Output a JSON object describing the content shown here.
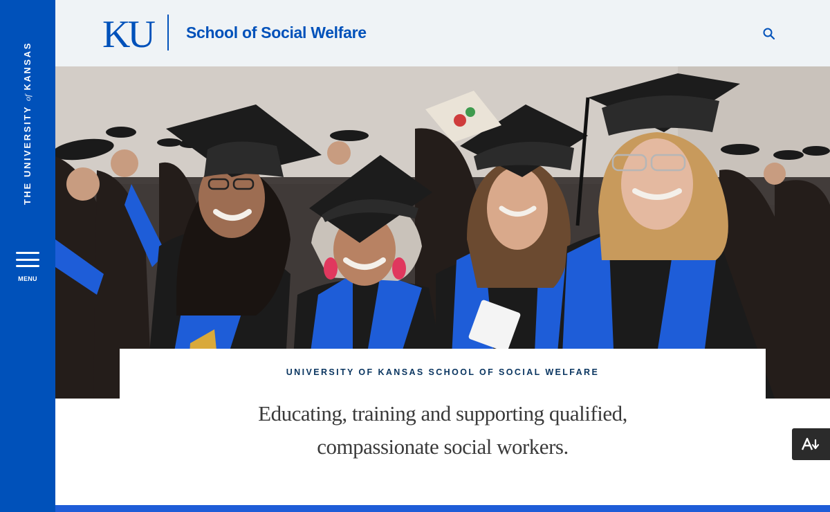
{
  "sidebar": {
    "wordmark_pre": "THE UNIVERSITY",
    "wordmark_of": "of",
    "wordmark_post": "KANSAS",
    "menu_label": "MENU",
    "menu_icon": "hamburger-icon"
  },
  "header": {
    "logo_text": "KU",
    "title": "School of Social Welfare",
    "search_icon": "search-icon"
  },
  "hero": {
    "eyebrow": "UNIVERSITY OF KANSAS SCHOOL OF SOCIAL WELFARE",
    "tagline_line1": "Educating, training and supporting qualified,",
    "tagline_line2": "compassionate social workers."
  },
  "accessibility": {
    "icon": "text-to-speech-icon"
  },
  "colors": {
    "ku_blue": "#0051ba",
    "header_bg": "#eff3f6",
    "eyebrow_navy": "#0a3560",
    "stole_blue": "#1e5dd8",
    "gown_black": "#1b1b1b"
  }
}
